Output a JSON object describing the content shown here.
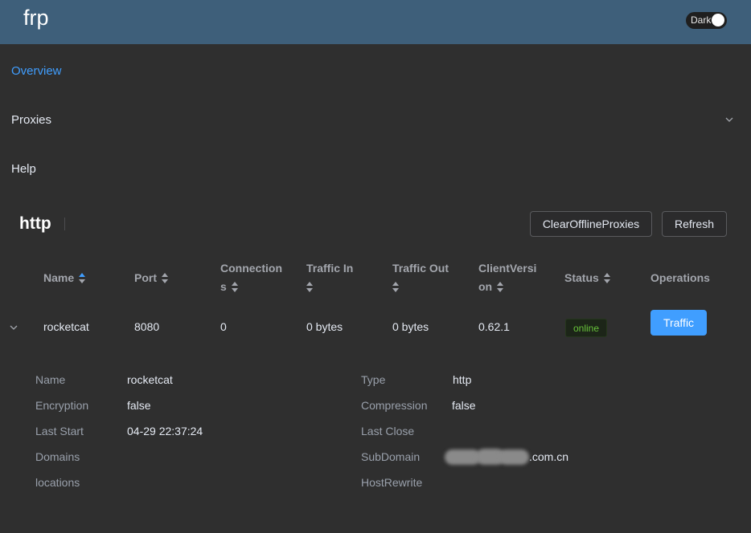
{
  "app": {
    "brand": "frp",
    "dark_toggle_label": "Dark"
  },
  "menu": [
    {
      "label": "Overview",
      "active": true
    },
    {
      "label": "Proxies",
      "active": false
    },
    {
      "label": "Help",
      "active": false
    }
  ],
  "section": {
    "title": "http",
    "clear_button": "ClearOfflineProxies",
    "refresh_button": "Refresh"
  },
  "table": {
    "columns": [
      {
        "line1": "Name",
        "line2": "",
        "sort": "asc"
      },
      {
        "line1": "Port",
        "line2": "",
        "sort": "none"
      },
      {
        "line1": "Connection",
        "line2": "s",
        "sort": "none"
      },
      {
        "line1": "Traffic In",
        "line2": "",
        "sort": "none"
      },
      {
        "line1": "Traffic Out",
        "line2": "",
        "sort": "none"
      },
      {
        "line1": "ClientVersi",
        "line2": "on",
        "sort": "none"
      },
      {
        "line1": "Status",
        "line2": "",
        "sort": "none"
      },
      {
        "line1": "Operations",
        "line2": "",
        "sort": "none"
      }
    ],
    "rows": [
      {
        "name": "rocketcat",
        "port": "8080",
        "connections": "0",
        "traffic_in": "0 bytes",
        "traffic_out": "0 bytes",
        "client_version": "0.62.1",
        "status": "online",
        "operation": "Traffic"
      }
    ]
  },
  "details": {
    "left": [
      {
        "label": "Name",
        "value": "rocketcat"
      },
      {
        "label": "Encryption",
        "value": "false"
      },
      {
        "label": "Last Start",
        "value": "04-29 22:37:24"
      },
      {
        "label": "Domains",
        "value": ""
      },
      {
        "label": "locations",
        "value": ""
      }
    ],
    "right": [
      {
        "label": "Type",
        "value": "http"
      },
      {
        "label": "Compression",
        "value": "false"
      },
      {
        "label": "Last Close",
        "value": ""
      },
      {
        "label": "SubDomain",
        "value": ".com.cn"
      },
      {
        "label": "HostRewrite",
        "value": ""
      }
    ]
  },
  "colors": {
    "header": "#3e5f7a",
    "background": "#2f2f2f",
    "accent": "#409eff",
    "success": "#67c23a"
  }
}
